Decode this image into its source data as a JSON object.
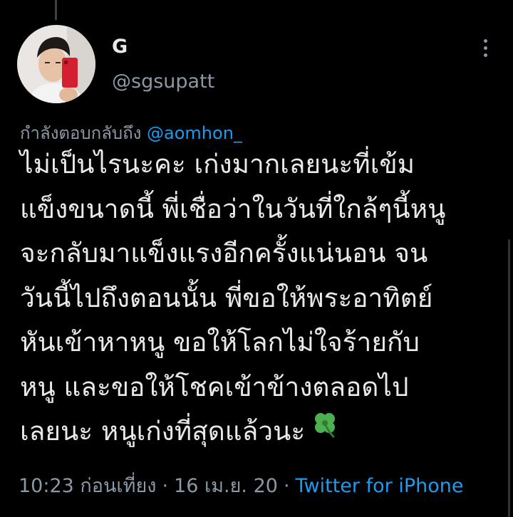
{
  "author": {
    "display_name": "G",
    "handle": "@sgsupatt"
  },
  "reply_context": {
    "prefix": "กำลังตอบกลับถึง",
    "mention": "@aomhon_"
  },
  "tweet": {
    "lines": [
      "ไม่เป็นไรนะคะ เก่งมากเลยนะที่เข้ม",
      "แข็งขนาดนี้ พี่เชื่อว่าในวันที่ใกล้ๆนี้หนู",
      "จะกลับมาแข็งแรงอีกครั้งแน่นอน จน",
      "วันนี้ไปถึงตอนนั้น พี่ขอให้พระอาทิตย์",
      "หันเข้าหาหนู ขอให้โลกไม่ใจร้ายกับ",
      "หนู และขอให้โชคเข้าข้างตลอดไป",
      "เลยนะ หนูเก่งที่สุดแล้วนะ"
    ],
    "emoji_icon": "four-leaf-clover"
  },
  "meta": {
    "time": "10:23 ก่อนเที่ยง",
    "date": "16 เม.ย. 20",
    "source": "Twitter for iPhone",
    "separator": "·"
  },
  "colors": {
    "background": "#000000",
    "primary_text": "#e7e9ea",
    "secondary_text": "#8b98a5",
    "link": "#1d9bf0"
  }
}
